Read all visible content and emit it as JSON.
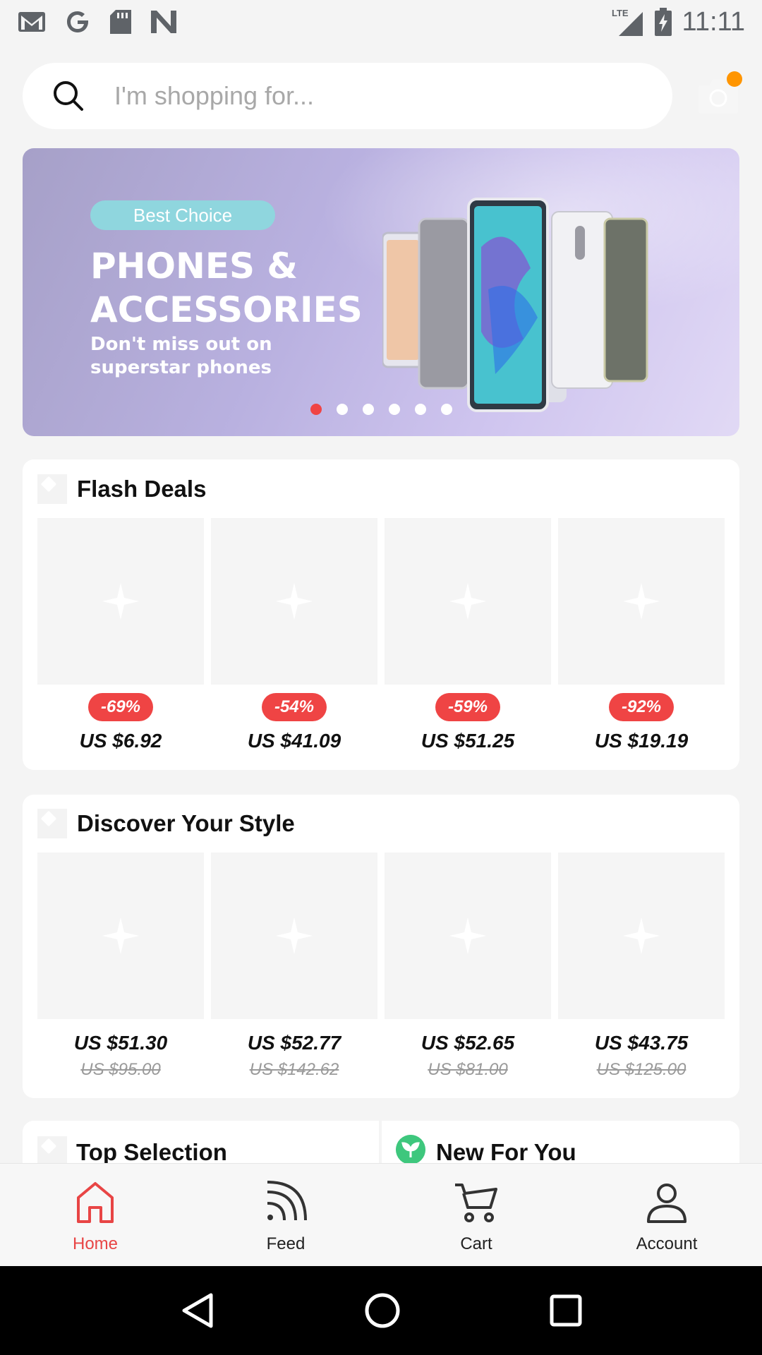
{
  "status_bar": {
    "time": "11:11",
    "network": "LTE",
    "left_icons": [
      "gmail-icon",
      "google-icon",
      "sd-card-icon",
      "n-icon"
    ]
  },
  "search": {
    "placeholder": "I'm shopping for..."
  },
  "banner": {
    "badge": "Best Choice",
    "title_line1": "PHONES &",
    "title_line2": "ACCESSORIES",
    "subtitle_line1": "Don't miss out on",
    "subtitle_line2": "superstar phones",
    "dots_total": 6,
    "active_dot": 1
  },
  "flash_deals": {
    "title": "Flash Deals",
    "items": [
      {
        "discount": "-69%",
        "price": "US $6.92"
      },
      {
        "discount": "-54%",
        "price": "US $41.09"
      },
      {
        "discount": "-59%",
        "price": "US $51.25"
      },
      {
        "discount": "-92%",
        "price": "US $19.19"
      }
    ]
  },
  "discover": {
    "title": "Discover Your Style",
    "items": [
      {
        "price": "US $51.30",
        "original": "US $95.00"
      },
      {
        "price": "US $52.77",
        "original": "US $142.62"
      },
      {
        "price": "US $52.65",
        "original": "US $81.00"
      },
      {
        "price": "US $43.75",
        "original": "US $125.00"
      }
    ]
  },
  "top_selection": {
    "title": "Top Selection"
  },
  "new_for_you": {
    "title": "New For You"
  },
  "bottom_nav": [
    {
      "label": "Home",
      "icon": "home-icon",
      "active": true
    },
    {
      "label": "Feed",
      "icon": "feed-icon",
      "active": false
    },
    {
      "label": "Cart",
      "icon": "cart-icon",
      "active": false
    },
    {
      "label": "Account",
      "icon": "account-icon",
      "active": false
    }
  ],
  "colors": {
    "accent": "#e84545",
    "discount_badge": "#ef4444",
    "camera_dot": "#ff9500",
    "leaf": "#3ec77d"
  }
}
